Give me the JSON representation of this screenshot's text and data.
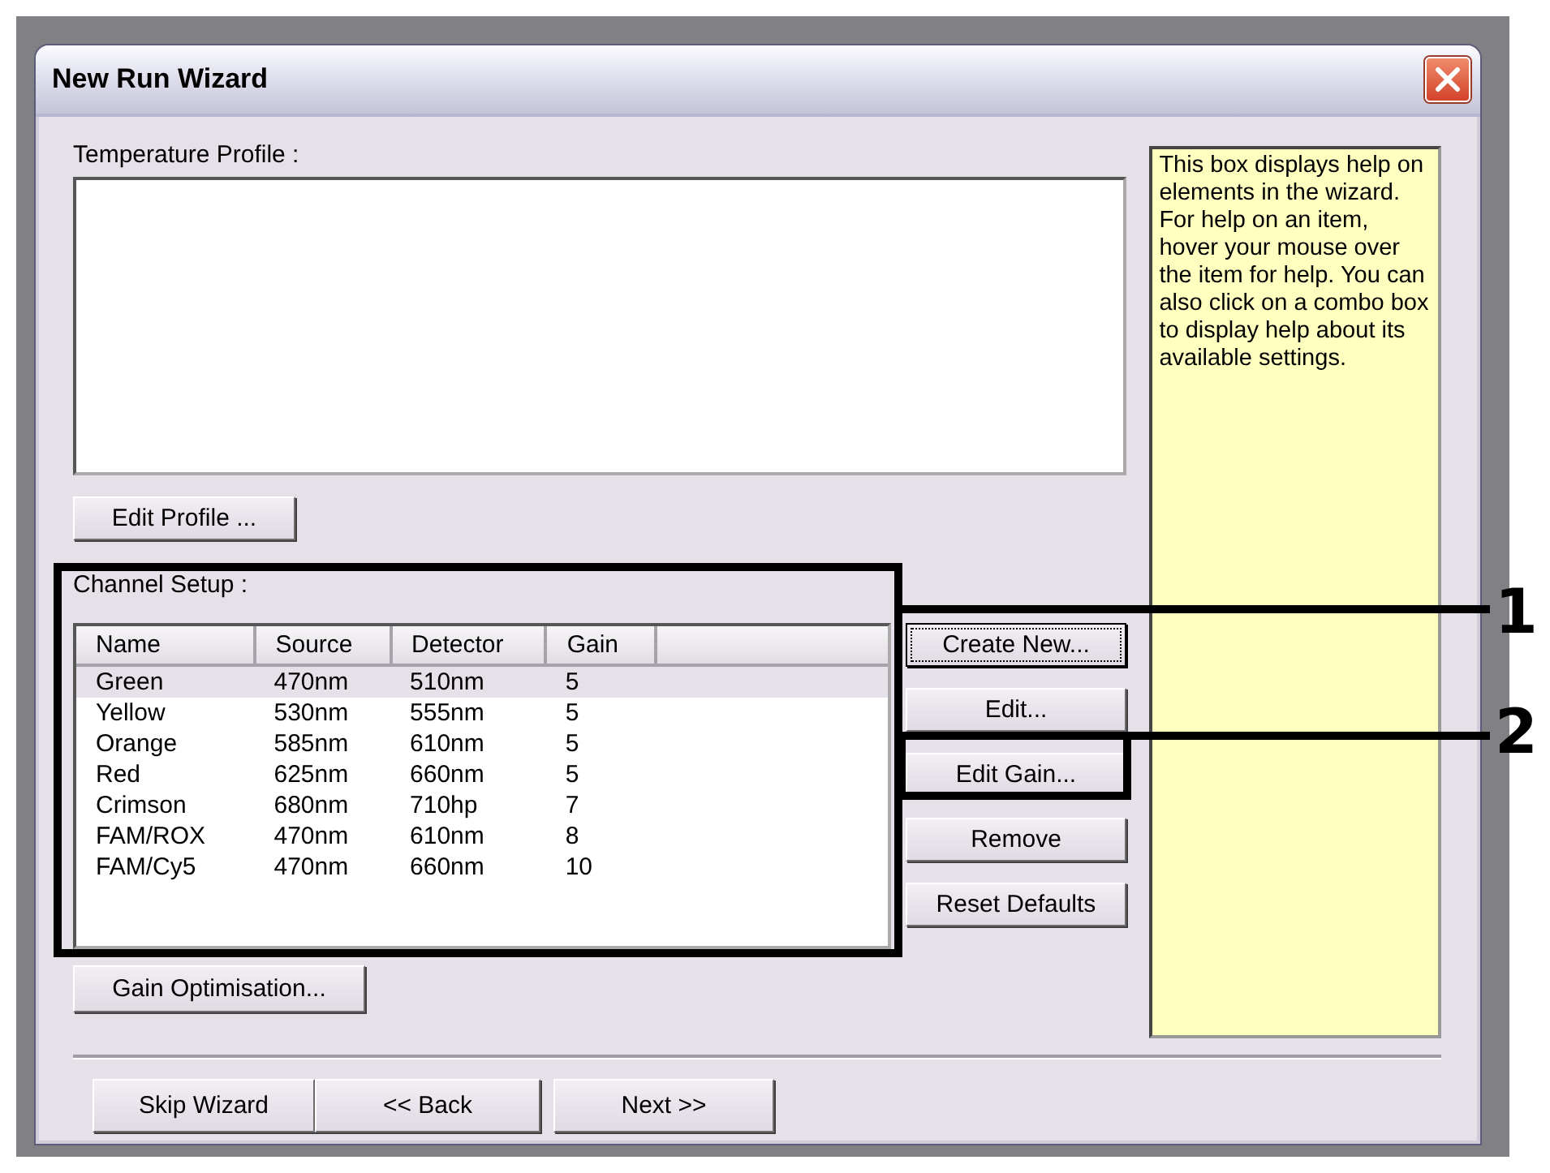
{
  "window": {
    "title": "New Run Wizard"
  },
  "temperature_profile": {
    "label": "Temperature Profile :",
    "edit_button": "Edit Profile ..."
  },
  "help_text": "This box displays help on elements in the wizard. For help on an item, hover your mouse over the item for help. You can also click on a combo box to display help about its available settings.",
  "channel_setup": {
    "label": "Channel Setup :",
    "columns": [
      "Name",
      "Source",
      "Detector",
      "Gain"
    ],
    "rows": [
      {
        "cells": [
          "Green",
          "470nm",
          "510nm",
          "5"
        ],
        "selected": true
      },
      {
        "cells": [
          "Yellow",
          "530nm",
          "555nm",
          "5"
        ],
        "selected": false
      },
      {
        "cells": [
          "Orange",
          "585nm",
          "610nm",
          "5"
        ],
        "selected": false
      },
      {
        "cells": [
          "Red",
          "625nm",
          "660nm",
          "5"
        ],
        "selected": false
      },
      {
        "cells": [
          "Crimson",
          "680nm",
          "710hp",
          "7"
        ],
        "selected": false
      },
      {
        "cells": [
          "FAM/ROX",
          "470nm",
          "610nm",
          "8"
        ],
        "selected": false
      },
      {
        "cells": [
          "FAM/Cy5",
          "470nm",
          "660nm",
          "10"
        ],
        "selected": false
      }
    ],
    "buttons": [
      {
        "label": "Create New...",
        "focused": true
      },
      {
        "label": "Edit...",
        "focused": false
      },
      {
        "label": "Edit Gain...",
        "focused": false
      },
      {
        "label": "Remove",
        "focused": false
      },
      {
        "label": "Reset Defaults",
        "focused": false
      }
    ],
    "gain_button": "Gain Optimisation..."
  },
  "footer_buttons": [
    "Skip Wizard",
    "<< Back",
    "Next >>"
  ],
  "callouts": [
    {
      "label": "1"
    },
    {
      "label": "2"
    }
  ]
}
